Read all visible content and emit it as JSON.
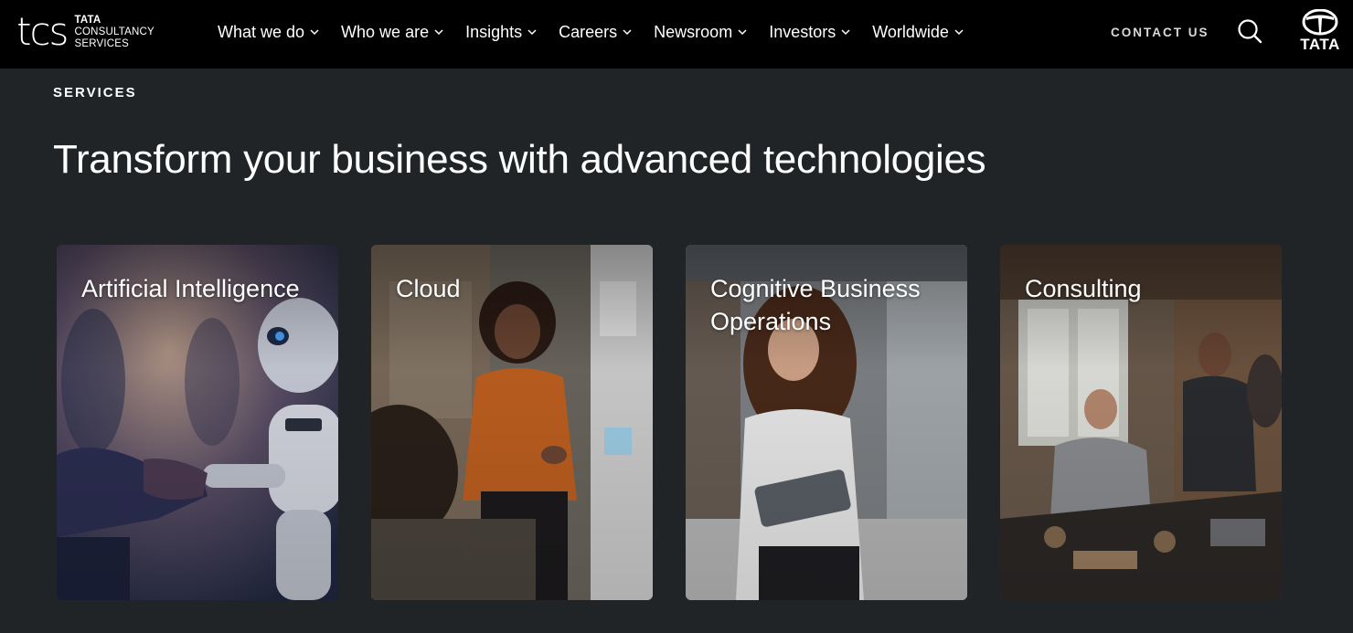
{
  "brand": {
    "logo_mark": "tcs",
    "logo_line1": "TATA",
    "logo_line2": "CONSULTANCY",
    "logo_line3": "SERVICES",
    "group_word": "TATA"
  },
  "nav": {
    "items": [
      {
        "label": "What we do"
      },
      {
        "label": "Who we are"
      },
      {
        "label": "Insights"
      },
      {
        "label": "Careers"
      },
      {
        "label": "Newsroom"
      },
      {
        "label": "Investors"
      },
      {
        "label": "Worldwide"
      }
    ],
    "contact_label": "CONTACT US"
  },
  "section": {
    "eyebrow": "SERVICES",
    "headline": "Transform your business with advanced technologies"
  },
  "cards": [
    {
      "title": "Artificial Intelligence"
    },
    {
      "title": "Cloud"
    },
    {
      "title": "Cognitive Business Operations"
    },
    {
      "title": "Consulting"
    }
  ],
  "colors": {
    "header_bg": "#000000",
    "page_bg": "#202426",
    "text": "#ffffff",
    "contact_text": "#d7d9da"
  }
}
